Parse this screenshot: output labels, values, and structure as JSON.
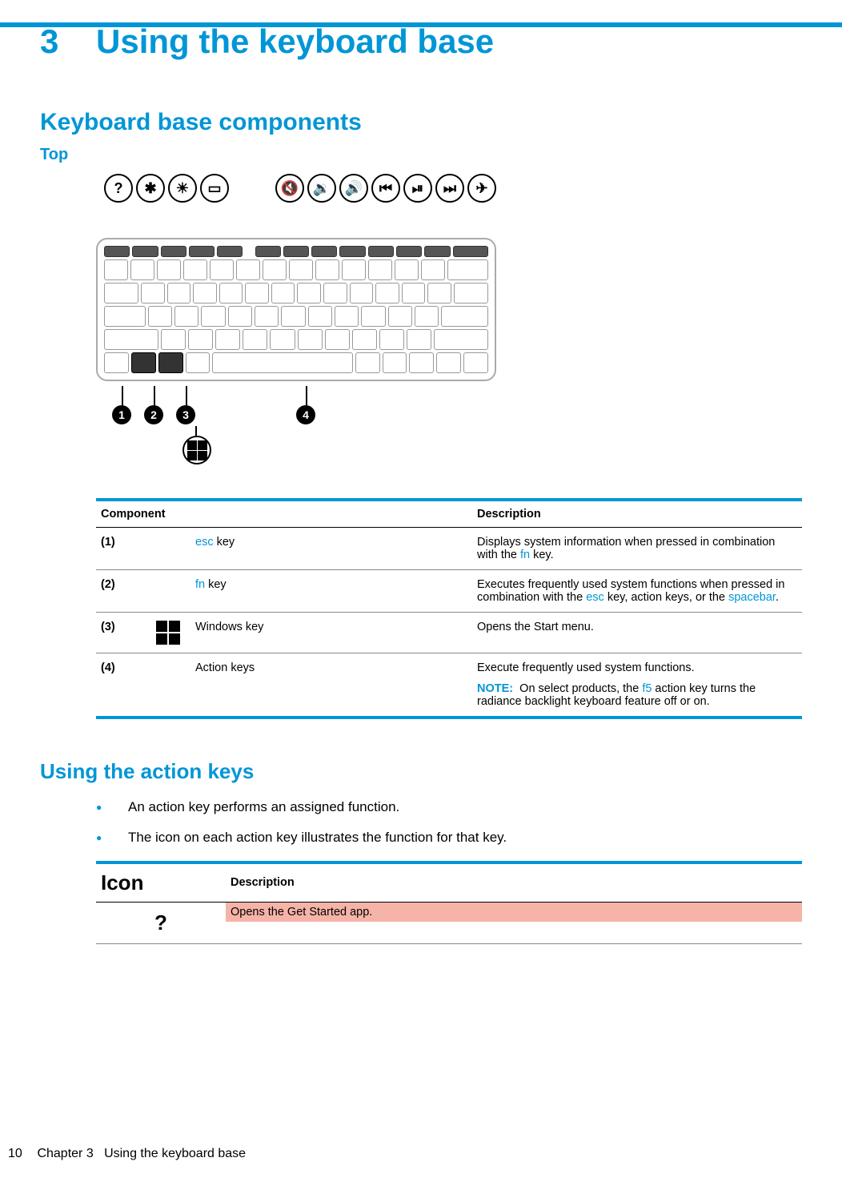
{
  "chapter": {
    "number": "3",
    "title": "Using the keyboard base"
  },
  "section1": "Keyboard base components",
  "subsection1": "Top",
  "fk_icons": {
    "group1": [
      "?",
      "✱",
      "☀",
      "▭"
    ],
    "group2": [
      "🔇",
      "🔉",
      "🔊",
      "⏮",
      "⏯",
      "⏭",
      "✈"
    ]
  },
  "callouts": {
    "c1": "1",
    "c2": "2",
    "c3": "3",
    "c4": "4"
  },
  "comp_table": {
    "headers": {
      "component": "Component",
      "description": "Description"
    },
    "rows": [
      {
        "num": "(1)",
        "icon": "",
        "name_pre": "",
        "name_link": "esc",
        "name_post": " key",
        "desc_pre": "Displays system information when pressed in combination with the ",
        "desc_link1": "fn",
        "desc_mid1": " key.",
        "desc_link2": "",
        "desc_mid2": "",
        "desc_link3": "",
        "desc_post": "",
        "note": ""
      },
      {
        "num": "(2)",
        "icon": "",
        "name_pre": "",
        "name_link": "fn",
        "name_post": " key",
        "desc_pre": "Executes frequently used system functions when pressed in combination with the ",
        "desc_link1": "esc",
        "desc_mid1": " key, action keys, or the ",
        "desc_link2": "spacebar",
        "desc_mid2": ".",
        "desc_link3": "",
        "desc_post": "",
        "note": ""
      },
      {
        "num": "(3)",
        "icon": "win",
        "name_pre": "Windows key",
        "name_link": "",
        "name_post": "",
        "desc_pre": "Opens the Start menu.",
        "desc_link1": "",
        "desc_mid1": "",
        "desc_link2": "",
        "desc_mid2": "",
        "desc_link3": "",
        "desc_post": "",
        "note": ""
      },
      {
        "num": "(4)",
        "icon": "",
        "name_pre": "Action keys",
        "name_link": "",
        "name_post": "",
        "desc_pre": "Execute frequently used system functions.",
        "desc_link1": "",
        "desc_mid1": "",
        "desc_link2": "",
        "desc_mid2": "",
        "desc_link3": "",
        "desc_post": "",
        "note_label": "NOTE:",
        "note_pre": "On select products, the ",
        "note_link": "f5",
        "note_post": " action key turns the radiance backlight keyboard feature off or on."
      }
    ]
  },
  "action_h": "Using the action keys",
  "bullets": [
    "An action key performs an assigned function.",
    "The icon on each action key illustrates the function for that key."
  ],
  "icon_table": {
    "headers": {
      "icon": "Icon",
      "description": "Description"
    },
    "rows": [
      {
        "icon": "?",
        "description": "Opens the Get Started app."
      }
    ]
  },
  "footer": {
    "page": "10",
    "chapter_label": "Chapter 3",
    "chapter_title": "Using the keyboard base"
  }
}
